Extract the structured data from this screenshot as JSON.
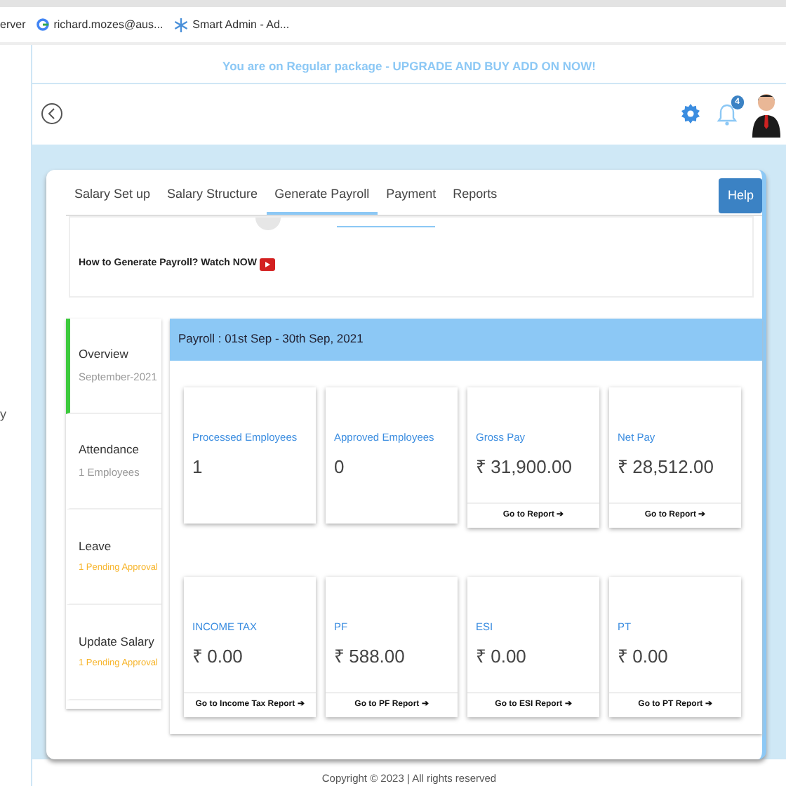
{
  "bookmarks": [
    {
      "label": "erver",
      "kind": "plain"
    },
    {
      "label": "richard.mozes@aus...",
      "kind": "google"
    },
    {
      "label": "Smart Admin - Ad...",
      "kind": "snowflake"
    }
  ],
  "banner": "You are on Regular package - UPGRADE AND BUY ADD ON NOW!",
  "header": {
    "notification_count": "4"
  },
  "side_edge_text": "y",
  "tabs": [
    {
      "label": "Salary Set up",
      "selected": false
    },
    {
      "label": "Salary Structure",
      "selected": false
    },
    {
      "label": "Generate Payroll",
      "selected": true
    },
    {
      "label": "Payment",
      "selected": false
    },
    {
      "label": "Reports",
      "selected": false
    }
  ],
  "help_button": "Help",
  "video_link": "How to Generate Payroll? Watch NOW",
  "sidebar": {
    "items": [
      {
        "title": "Overview",
        "subtitle": "September-2021",
        "kind": "info",
        "selected": true
      },
      {
        "title": "Attendance",
        "subtitle": "1 Employees",
        "kind": "info",
        "selected": false
      },
      {
        "title": "Leave",
        "subtitle": "1 Pending Approval",
        "kind": "pending",
        "selected": false
      },
      {
        "title": "Update Salary",
        "subtitle": "1 Pending Approval",
        "kind": "pending",
        "selected": false
      }
    ]
  },
  "period_title": "Payroll : 01st Sep - 30th Sep, 2021",
  "cards": [
    [
      {
        "label": "Processed Employees",
        "value": "1"
      },
      {
        "label": "Approved Employees",
        "value": "0"
      },
      {
        "label": "Gross Pay",
        "value": "₹ 31,900.00",
        "link": "Go to Report ➔"
      },
      {
        "label": "Net Pay",
        "value": "₹ 28,512.00",
        "link": "Go to Report ➔"
      }
    ],
    [
      {
        "label": "INCOME TAX",
        "value": "₹ 0.00",
        "link": "Go to Income Tax Report ➔"
      },
      {
        "label": "PF",
        "value": "₹ 588.00",
        "link": "Go to PF Report ➔"
      },
      {
        "label": "ESI",
        "value": "₹ 0.00",
        "link": "Go to ESI Report ➔"
      },
      {
        "label": "PT",
        "value": "₹ 0.00",
        "link": "Go to PT Report ➔"
      }
    ]
  ],
  "footer": "Copyright © 2023 | All rights reserved"
}
